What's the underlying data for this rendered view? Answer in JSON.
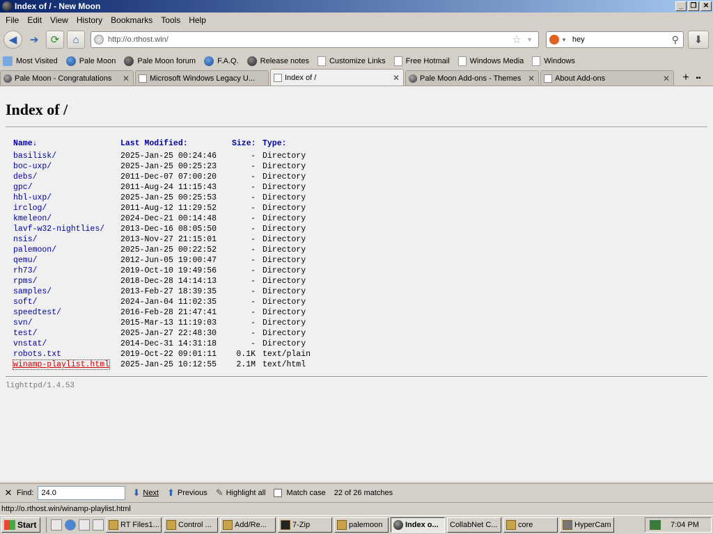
{
  "window": {
    "title": "Index of / - New Moon"
  },
  "menu": [
    "File",
    "Edit",
    "View",
    "History",
    "Bookmarks",
    "Tools",
    "Help"
  ],
  "nav": {
    "url": "http://o.rthost.win/",
    "search_value": "hey"
  },
  "bookmarks": [
    "Most Visited",
    "Pale Moon",
    "Pale Moon forum",
    "F.A.Q.",
    "Release notes",
    "Customize Links",
    "Free Hotmail",
    "Windows Media",
    "Windows"
  ],
  "tabs": [
    {
      "label": "Pale Moon - Congratulations"
    },
    {
      "label": "Microsoft Windows Legacy U..."
    },
    {
      "label": "Index of /"
    },
    {
      "label": "Pale Moon Add-ons - Themes"
    },
    {
      "label": "About Add-ons"
    }
  ],
  "page": {
    "heading": "Index of /",
    "columns": {
      "name": "Name",
      "sort_arrow": "↓",
      "modified": "Last Modified:",
      "size": "Size:",
      "type": "Type:"
    },
    "rows": [
      {
        "name": "basilisk/",
        "modified": "2025-Jan-25 00:24:46",
        "size": "-",
        "type": "Directory"
      },
      {
        "name": "boc-uxp/",
        "modified": "2025-Jan-25 00:25:23",
        "size": "-",
        "type": "Directory"
      },
      {
        "name": "debs/",
        "modified": "2011-Dec-07 07:00:20",
        "size": "-",
        "type": "Directory"
      },
      {
        "name": "gpc/",
        "modified": "2011-Aug-24 11:15:43",
        "size": "-",
        "type": "Directory"
      },
      {
        "name": "hbl-uxp/",
        "modified": "2025-Jan-25 00:25:53",
        "size": "-",
        "type": "Directory"
      },
      {
        "name": "irclog/",
        "modified": "2011-Aug-12 11:29:52",
        "size": "-",
        "type": "Directory"
      },
      {
        "name": "kmeleon/",
        "modified": "2024-Dec-21 00:14:48",
        "size": "-",
        "type": "Directory"
      },
      {
        "name": "lavf-w32-nightlies/",
        "modified": "2013-Dec-16 08:05:50",
        "size": "-",
        "type": "Directory"
      },
      {
        "name": "nsis/",
        "modified": "2013-Nov-27 21:15:01",
        "size": "-",
        "type": "Directory"
      },
      {
        "name": "palemoon/",
        "modified": "2025-Jan-25 00:22:52",
        "size": "-",
        "type": "Directory"
      },
      {
        "name": "qemu/",
        "modified": "2012-Jun-05 19:00:47",
        "size": "-",
        "type": "Directory"
      },
      {
        "name": "rh73/",
        "modified": "2019-Oct-10 19:49:56",
        "size": "-",
        "type": "Directory"
      },
      {
        "name": "rpms/",
        "modified": "2018-Dec-28 14:14:13",
        "size": "-",
        "type": "Directory"
      },
      {
        "name": "samples/",
        "modified": "2013-Feb-27 18:39:35",
        "size": "-",
        "type": "Directory"
      },
      {
        "name": "soft/",
        "modified": "2024-Jan-04 11:02:35",
        "size": "-",
        "type": "Directory"
      },
      {
        "name": "speedtest/",
        "modified": "2016-Feb-28 21:47:41",
        "size": "-",
        "type": "Directory"
      },
      {
        "name": "svn/",
        "modified": "2015-Mar-13 11:19:03",
        "size": "-",
        "type": "Directory"
      },
      {
        "name": "test/",
        "modified": "2025-Jan-27 22:48:30",
        "size": "-",
        "type": "Directory"
      },
      {
        "name": "vnstat/",
        "modified": "2014-Dec-31 14:31:18",
        "size": "-",
        "type": "Directory"
      },
      {
        "name": "robots.txt",
        "modified": "2019-Oct-22 09:01:11",
        "size": "0.1K",
        "type": "text/plain"
      },
      {
        "name": "winamp-playlist.html",
        "modified": "2025-Jan-25 10:12:55",
        "size": "2.1M",
        "type": "text/html"
      }
    ],
    "footer": "lighttpd/1.4.53"
  },
  "findbar": {
    "label": "Find:",
    "value": "24.0",
    "next": "Next",
    "previous": "Previous",
    "highlight_all": "Highlight all",
    "match_case": "Match case",
    "matches": "22 of 26 matches"
  },
  "status": "http://o.rthost.win/winamp-playlist.html",
  "taskbar": {
    "start": "Start",
    "items": [
      "RT Files1...",
      "Control ...",
      "Add/Re...",
      "7-Zip",
      "palemoon",
      "Index o...",
      "CollabNet C...",
      "core",
      "HyperCam"
    ],
    "clock": "7:04 PM"
  }
}
